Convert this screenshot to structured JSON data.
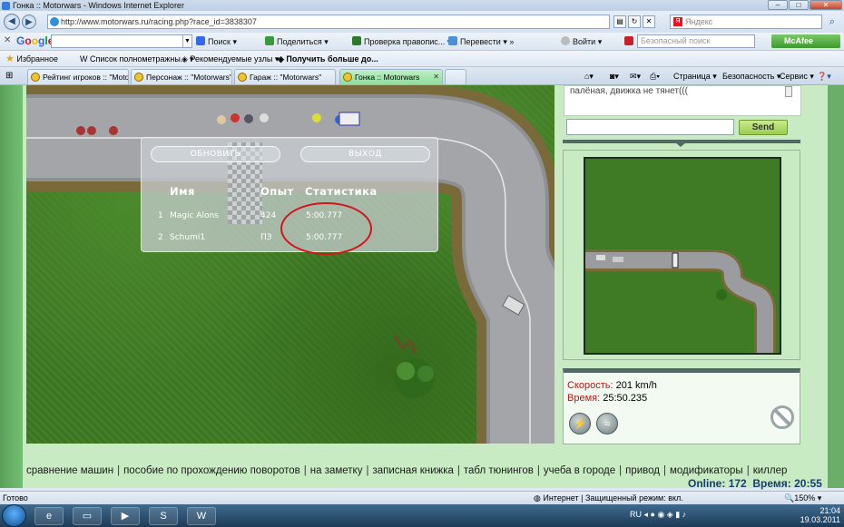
{
  "window": {
    "title": "Гонка :: Motorwars - Windows Internet Explorer"
  },
  "address": {
    "url": "http://www.motorwars.ru/racing.php?race_id=3838307",
    "search_placeholder": "Яндекс"
  },
  "google_toolbar": {
    "logo": {
      "b": "G",
      "o1": "o",
      "o2": "o",
      "g": "g",
      "l": "l",
      "e": "e"
    },
    "items": [
      "Поиск",
      "Поделиться",
      "Проверка правопис...",
      "Перевести",
      "Войти"
    ],
    "safe_search_placeholder": "Безопасный поиск",
    "mcafee": "McAfee"
  },
  "favorites": {
    "label": "Избранное",
    "items": [
      "Список полнометражны...",
      "Рекомендуемые узлы",
      "Получить больше до..."
    ]
  },
  "tabs": [
    {
      "label": "Рейтинг игроков :: \"Moto..."
    },
    {
      "label": "Персонаж :: \"Motorwars\""
    },
    {
      "label": "Гараж :: \"Motorwars\""
    },
    {
      "label": "Гонка :: Motorwars"
    }
  ],
  "command_bar": {
    "page": "Страница",
    "safety": "Безопасность",
    "service": "Сервис"
  },
  "results_panel": {
    "refresh_button": "ОБНОВИТЬ",
    "exit_button": "ВЫХОД",
    "headers": {
      "name": "Имя",
      "exp": "Опыт",
      "stats": "Статистика"
    },
    "rows": [
      {
        "pos": "1",
        "name": "Magic Alons",
        "exp": "424",
        "time": "5:00.777"
      },
      {
        "pos": "2",
        "name": "Schumi1",
        "exp": "ПЗ",
        "time": "5:00.777"
      }
    ]
  },
  "chat": {
    "last_message": "палёная, движка не тянет(((",
    "send_button": "Send"
  },
  "race_info": {
    "speed_label": "Скорость:",
    "speed_value": "201 km/h",
    "time_label": "Время:",
    "time_value": "25:50.235"
  },
  "footer_links": [
    "сравнение машин",
    "пособие по прохождению поворотов",
    "на заметку",
    "записная книжка",
    "табл тюнингов",
    "учеба в городе",
    "привод",
    "модификаторы",
    "киллер"
  ],
  "online": {
    "label": "Online:",
    "count": "172",
    "time_label": "Время:",
    "time": "20:55"
  },
  "status": {
    "left": "Готово",
    "zone": "Интернет | Защищенный режим: вкл.",
    "zoom": "150%"
  },
  "taskbar": {
    "lang": "RU",
    "clock": "21:04",
    "date": "19.03.2011"
  },
  "colors": {
    "send_button": "#a9d860",
    "active_tab": "#9fe0ad",
    "label_red": "#c21313",
    "circle": "#d6121b"
  }
}
